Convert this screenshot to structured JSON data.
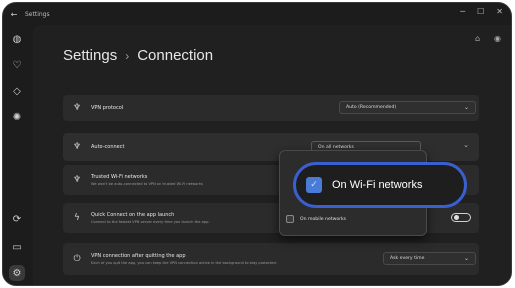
{
  "window": {
    "title": "Settings",
    "back_icon": "back-arrow-icon",
    "controls": [
      "minimize-icon",
      "maximize-icon",
      "close-icon"
    ]
  },
  "rail": {
    "items": [
      {
        "icon": "globe-icon"
      },
      {
        "icon": "shield-heart-icon"
      },
      {
        "icon": "gem-icon"
      },
      {
        "icon": "antivirus-icon"
      },
      {
        "icon": "gear-power-icon"
      },
      {
        "icon": "device-icon"
      },
      {
        "icon": "settings-gear-icon",
        "active": true
      }
    ]
  },
  "header": {
    "title": "Settings",
    "separator": "›",
    "current": "Connection"
  },
  "rows": {
    "vpn_protocol": {
      "label": "VPN protocol",
      "value": "Auto (Recommended)"
    },
    "auto_connect": {
      "label": "Auto-connect",
      "value": "On all networks"
    },
    "trusted_wifi": {
      "label": "Trusted Wi-Fi networks",
      "description": "We won't be auto-connected to VPN on trusted Wi-Fi networks"
    },
    "quick_connect": {
      "label": "Quick Connect on the app launch",
      "description": "Connect to the fastest VPN server every time you launch the app."
    },
    "vpn_quit": {
      "label": "VPN connection after quitting the app",
      "description": "Each of you quit the app, you can keep the VPN connection active in the background to stay protected.",
      "value": "Ask every time"
    }
  },
  "popup": {
    "options": [
      {
        "label": "On Wi-Fi networks",
        "checked": true
      },
      {
        "label": "On mobile networks",
        "checked": false
      }
    ]
  },
  "colors": {
    "accent": "#3a5fd0",
    "check": "#4a7bd6",
    "background": "#1c1c1c",
    "card": "#2b2b2b"
  }
}
